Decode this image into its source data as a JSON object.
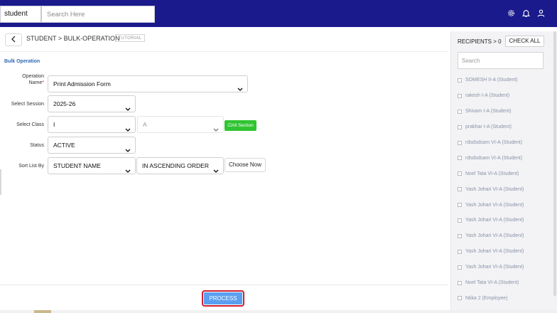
{
  "header": {
    "context_value": "student",
    "search_placeholder": "Search Here",
    "icons": [
      "gear-icon",
      "bell-icon",
      "user-icon"
    ]
  },
  "breadcrumb": {
    "text": "STUDENT > BULK-OPERATION",
    "tutorial": "TUTORIAL"
  },
  "section_title": "Bulk Operation",
  "form": {
    "operation_label_1": "Operation",
    "operation_label_2": "Name",
    "operation_required": "*",
    "operation_value": "Print Admission Form",
    "session_label": "Select Session",
    "session_value": "2025-26",
    "class_label": "Select Class",
    "class_value": "I",
    "section_value": "A",
    "all_section_label": "All Section",
    "status_label": "Status",
    "status_value": "ACTIVE",
    "sort_label": "Sort List By",
    "sort_value": "STUDENT NAME",
    "order_value": "IN ASCENDING ORDER",
    "choose_now": "Choose Now"
  },
  "process_label": "PROCESS",
  "recipients": {
    "title": "RECIPIENTS > 0",
    "check_all": "CHECK ALL",
    "search_placeholder": "Search",
    "items": [
      "SOMESH II-A (Student)",
      "rakesh I-A (Student)",
      "Shivam I-A (Student)",
      "prakhar I-A (Student)",
      "rdsdsdsam VI-A (Student)",
      "rdsdsdsam VI-A (Student)",
      "Noel Tata VI-A (Student)",
      "Yash Johari VI-A (Student)",
      "Yash Johari VI-A (Student)",
      "Yash Johari VI-A (Student)",
      "Yash Johari VI-A (Student)",
      "Yash Johari VI-A (Student)",
      "Yash Johari VI-A (Student)",
      "Noel Tata VI-A (Student)",
      "Ntika 2 (Employee)"
    ]
  },
  "colors": {
    "header_bg": "#1a1a8c",
    "accent": "#2f67b8",
    "process_bg": "#5a9ff0",
    "all_section_bg": "#31c431"
  }
}
